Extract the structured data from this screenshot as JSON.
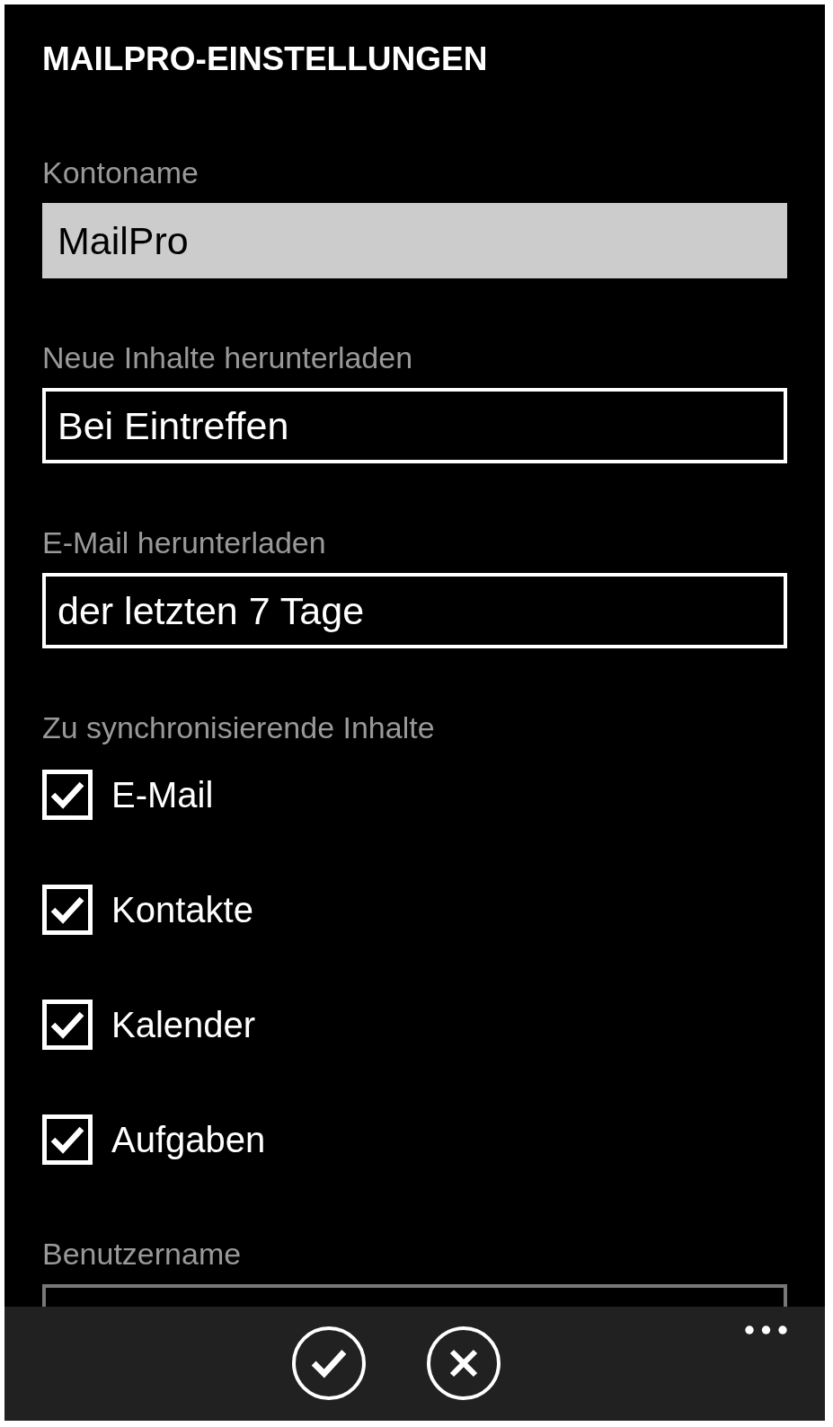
{
  "page_title": "MAILPRO-EINSTELLUNGEN",
  "sections": [
    {
      "kind": "textbox",
      "label": "Kontoname",
      "value": "MailPro",
      "disabled": false
    },
    {
      "kind": "picker",
      "label": "Neue Inhalte herunterladen",
      "value": "Bei Eintreffen",
      "disabled": false
    },
    {
      "kind": "picker",
      "label": "E-Mail herunterladen",
      "value": "der letzten 7 Tage",
      "disabled": false
    },
    {
      "kind": "checklist",
      "label": "Zu synchronisierende Inhalte",
      "items": [
        {
          "label": "E-Mail",
          "checked": true
        },
        {
          "label": "Kontakte",
          "checked": true
        },
        {
          "label": "Kalender",
          "checked": true
        },
        {
          "label": "Aufgaben",
          "checked": true
        }
      ]
    },
    {
      "kind": "textbox",
      "label": "Benutzername",
      "disabled": true
    }
  ],
  "app_bar": {
    "buttons": [
      {
        "kind": "check"
      },
      {
        "kind": "close"
      },
      {
        "kind": "more"
      }
    ]
  }
}
